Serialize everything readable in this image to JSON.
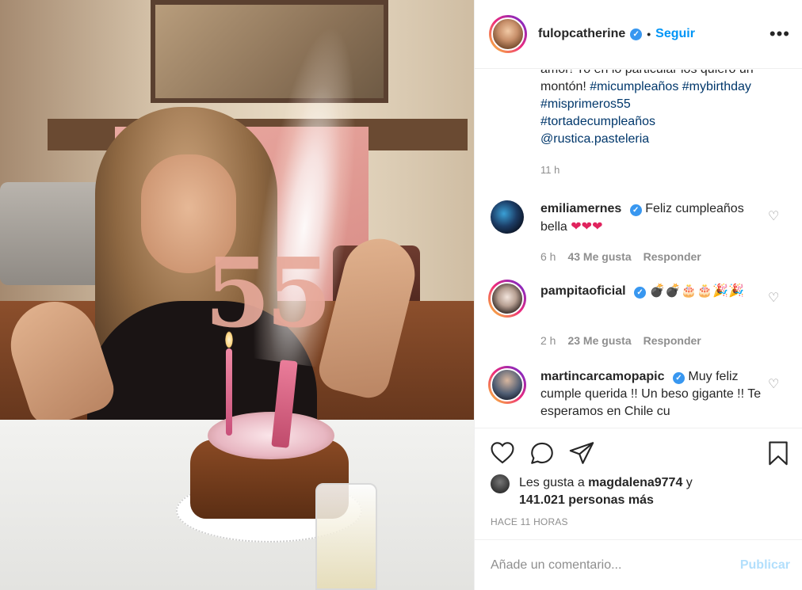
{
  "post": {
    "username": "fulopcatherine",
    "follow_label": "Seguir",
    "more_label": "•••",
    "caption": {
      "cut_line": "amor! Yo en lo particular los quiero un",
      "line2_prefix": "montón! ",
      "tags": [
        "#micumpleaños",
        "#mybirthday",
        "#misprimeros55",
        "#tortadecumpleaños"
      ],
      "mention": "@rustica.pasteleria"
    },
    "caption_time": "11 h"
  },
  "comments": [
    {
      "username": "emiliamernes",
      "verified": true,
      "text": "Feliz cumpleaños bella ",
      "emoji": "❤❤❤",
      "time": "6 h",
      "likes": "43 Me gusta",
      "reply": "Responder"
    },
    {
      "username": "pampitaoficial",
      "verified": true,
      "text": "",
      "emoji": "💣💣🎂🎂🎉🎉",
      "time": "2 h",
      "likes": "23 Me gusta",
      "reply": "Responder"
    },
    {
      "username": "martincarcamopapic",
      "verified": true,
      "text": "Muy feliz cumple querida !! Un beso gigante !! Te esperamos en Chile cu",
      "emoji": "",
      "time": "",
      "likes": "",
      "reply": ""
    }
  ],
  "likes": {
    "prefix": "Les gusta a ",
    "user": "magdalena9774",
    "suffix": " y",
    "count": "141.021 personas más"
  },
  "post_time": "HACE 11 HORAS",
  "comment_box": {
    "placeholder": "Añade un comentario...",
    "publish_label": "Publicar"
  },
  "photo": {
    "cake_number": "55"
  },
  "colors": {
    "link": "#00376b",
    "follow": "#0095f6",
    "verified": "#3897f0",
    "publish_disabled": "#b2dffc",
    "meta": "#8e8e8e"
  }
}
